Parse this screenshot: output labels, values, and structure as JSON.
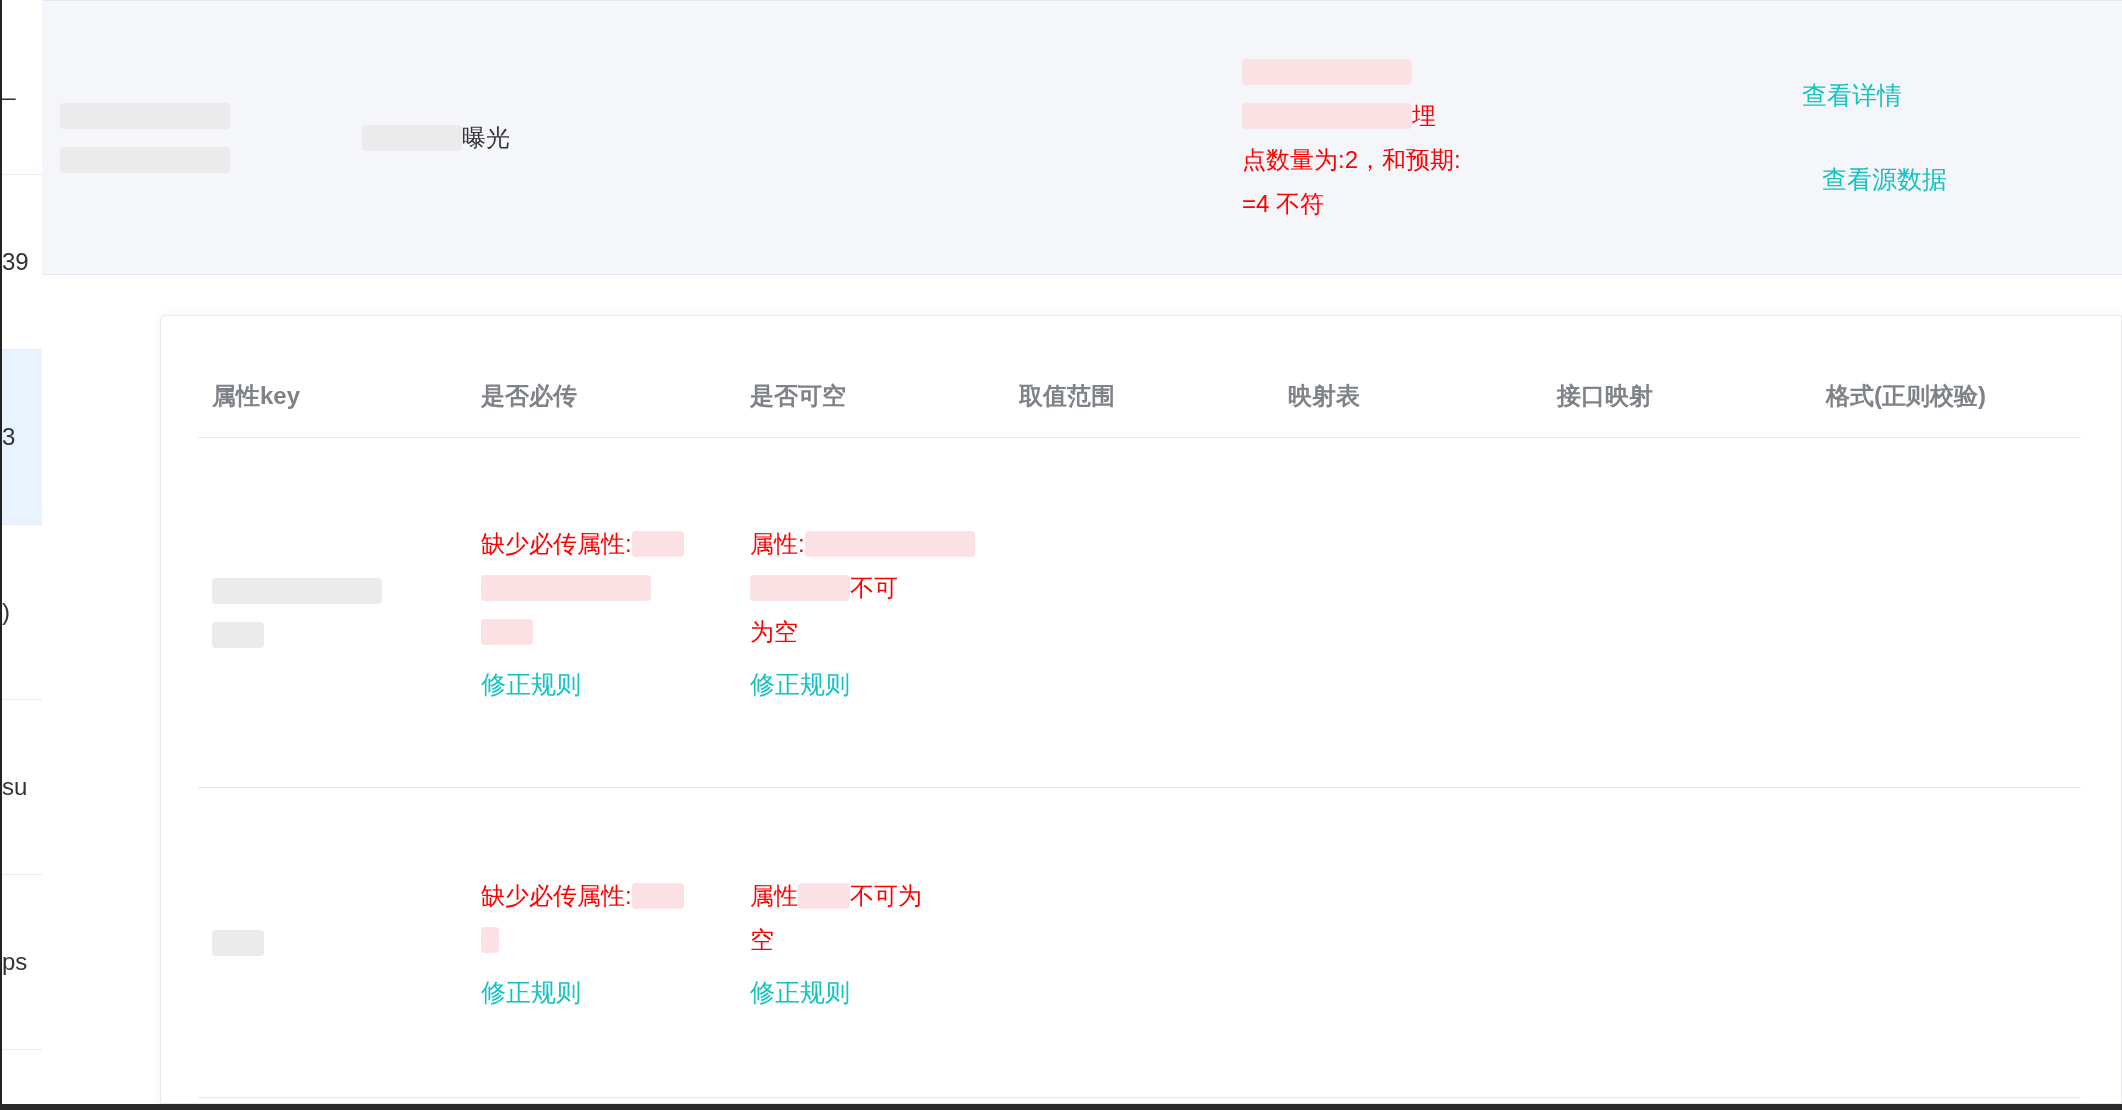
{
  "left_column": {
    "items": [
      {
        "text": "_",
        "selected": false
      },
      {
        "text": "39",
        "selected": false
      },
      {
        "text": "3",
        "selected": true
      },
      {
        "text": ")",
        "selected": false
      },
      {
        "text": "su",
        "selected": false
      },
      {
        "text": "ps",
        "selected": false
      }
    ]
  },
  "top_row": {
    "key_lines": [
      [
        {
          "kind": "mask_long"
        }
      ],
      [
        {
          "kind": "mask_long"
        }
      ]
    ],
    "name_lines": [
      [
        {
          "kind": "mask_medium"
        },
        {
          "kind": "text",
          "text": "曝光"
        }
      ]
    ],
    "message_lines": [
      [
        {
          "kind": "mask_long"
        }
      ],
      [
        {
          "kind": "mask_long"
        },
        {
          "kind": "text",
          "text": "埋"
        }
      ],
      [
        {
          "kind": "text",
          "text": "点数量为:2，和预期:"
        }
      ],
      [
        {
          "kind": "text",
          "text": "=4 不符"
        }
      ]
    ],
    "actions": [
      "查看详情",
      "查看源数据"
    ]
  },
  "table": {
    "columns": [
      "属性key",
      "是否必传",
      "是否可空",
      "取值范围",
      "映射表",
      "接口映射",
      "格式(正则校验)"
    ],
    "rows": [
      {
        "key_lines": [
          [
            {
              "kind": "mask_long"
            }
          ],
          [
            {
              "kind": "mask_short"
            }
          ]
        ],
        "required": {
          "lines": [
            [
              {
                "kind": "text",
                "text": "缺少必传属性:"
              },
              {
                "kind": "mask_short"
              }
            ],
            [
              {
                "kind": "mask_long"
              }
            ],
            [
              {
                "kind": "mask_short"
              }
            ]
          ],
          "action": "修正规则"
        },
        "nullable": {
          "lines": [
            [
              {
                "kind": "text",
                "text": "属性:"
              },
              {
                "kind": "mask_long"
              }
            ],
            [
              {
                "kind": "mask_medium"
              },
              {
                "kind": "text",
                "text": "不可"
              }
            ],
            [
              {
                "kind": "text",
                "text": "为空"
              }
            ]
          ],
          "action": "修正规则"
        }
      },
      {
        "key_lines": [
          [
            {
              "kind": "mask_short"
            }
          ]
        ],
        "required": {
          "lines": [
            [
              {
                "kind": "text",
                "text": "缺少必传属性:"
              },
              {
                "kind": "mask_short"
              }
            ],
            [
              {
                "kind": "mask_tiny"
              }
            ]
          ],
          "action": "修正规则"
        },
        "nullable": {
          "lines": [
            [
              {
                "kind": "text",
                "text": "属性"
              },
              {
                "kind": "mask_short"
              },
              {
                "kind": "text",
                "text": "不可为"
              }
            ],
            [
              {
                "kind": "text",
                "text": "空"
              }
            ]
          ],
          "action": "修正规则"
        }
      }
    ]
  }
}
